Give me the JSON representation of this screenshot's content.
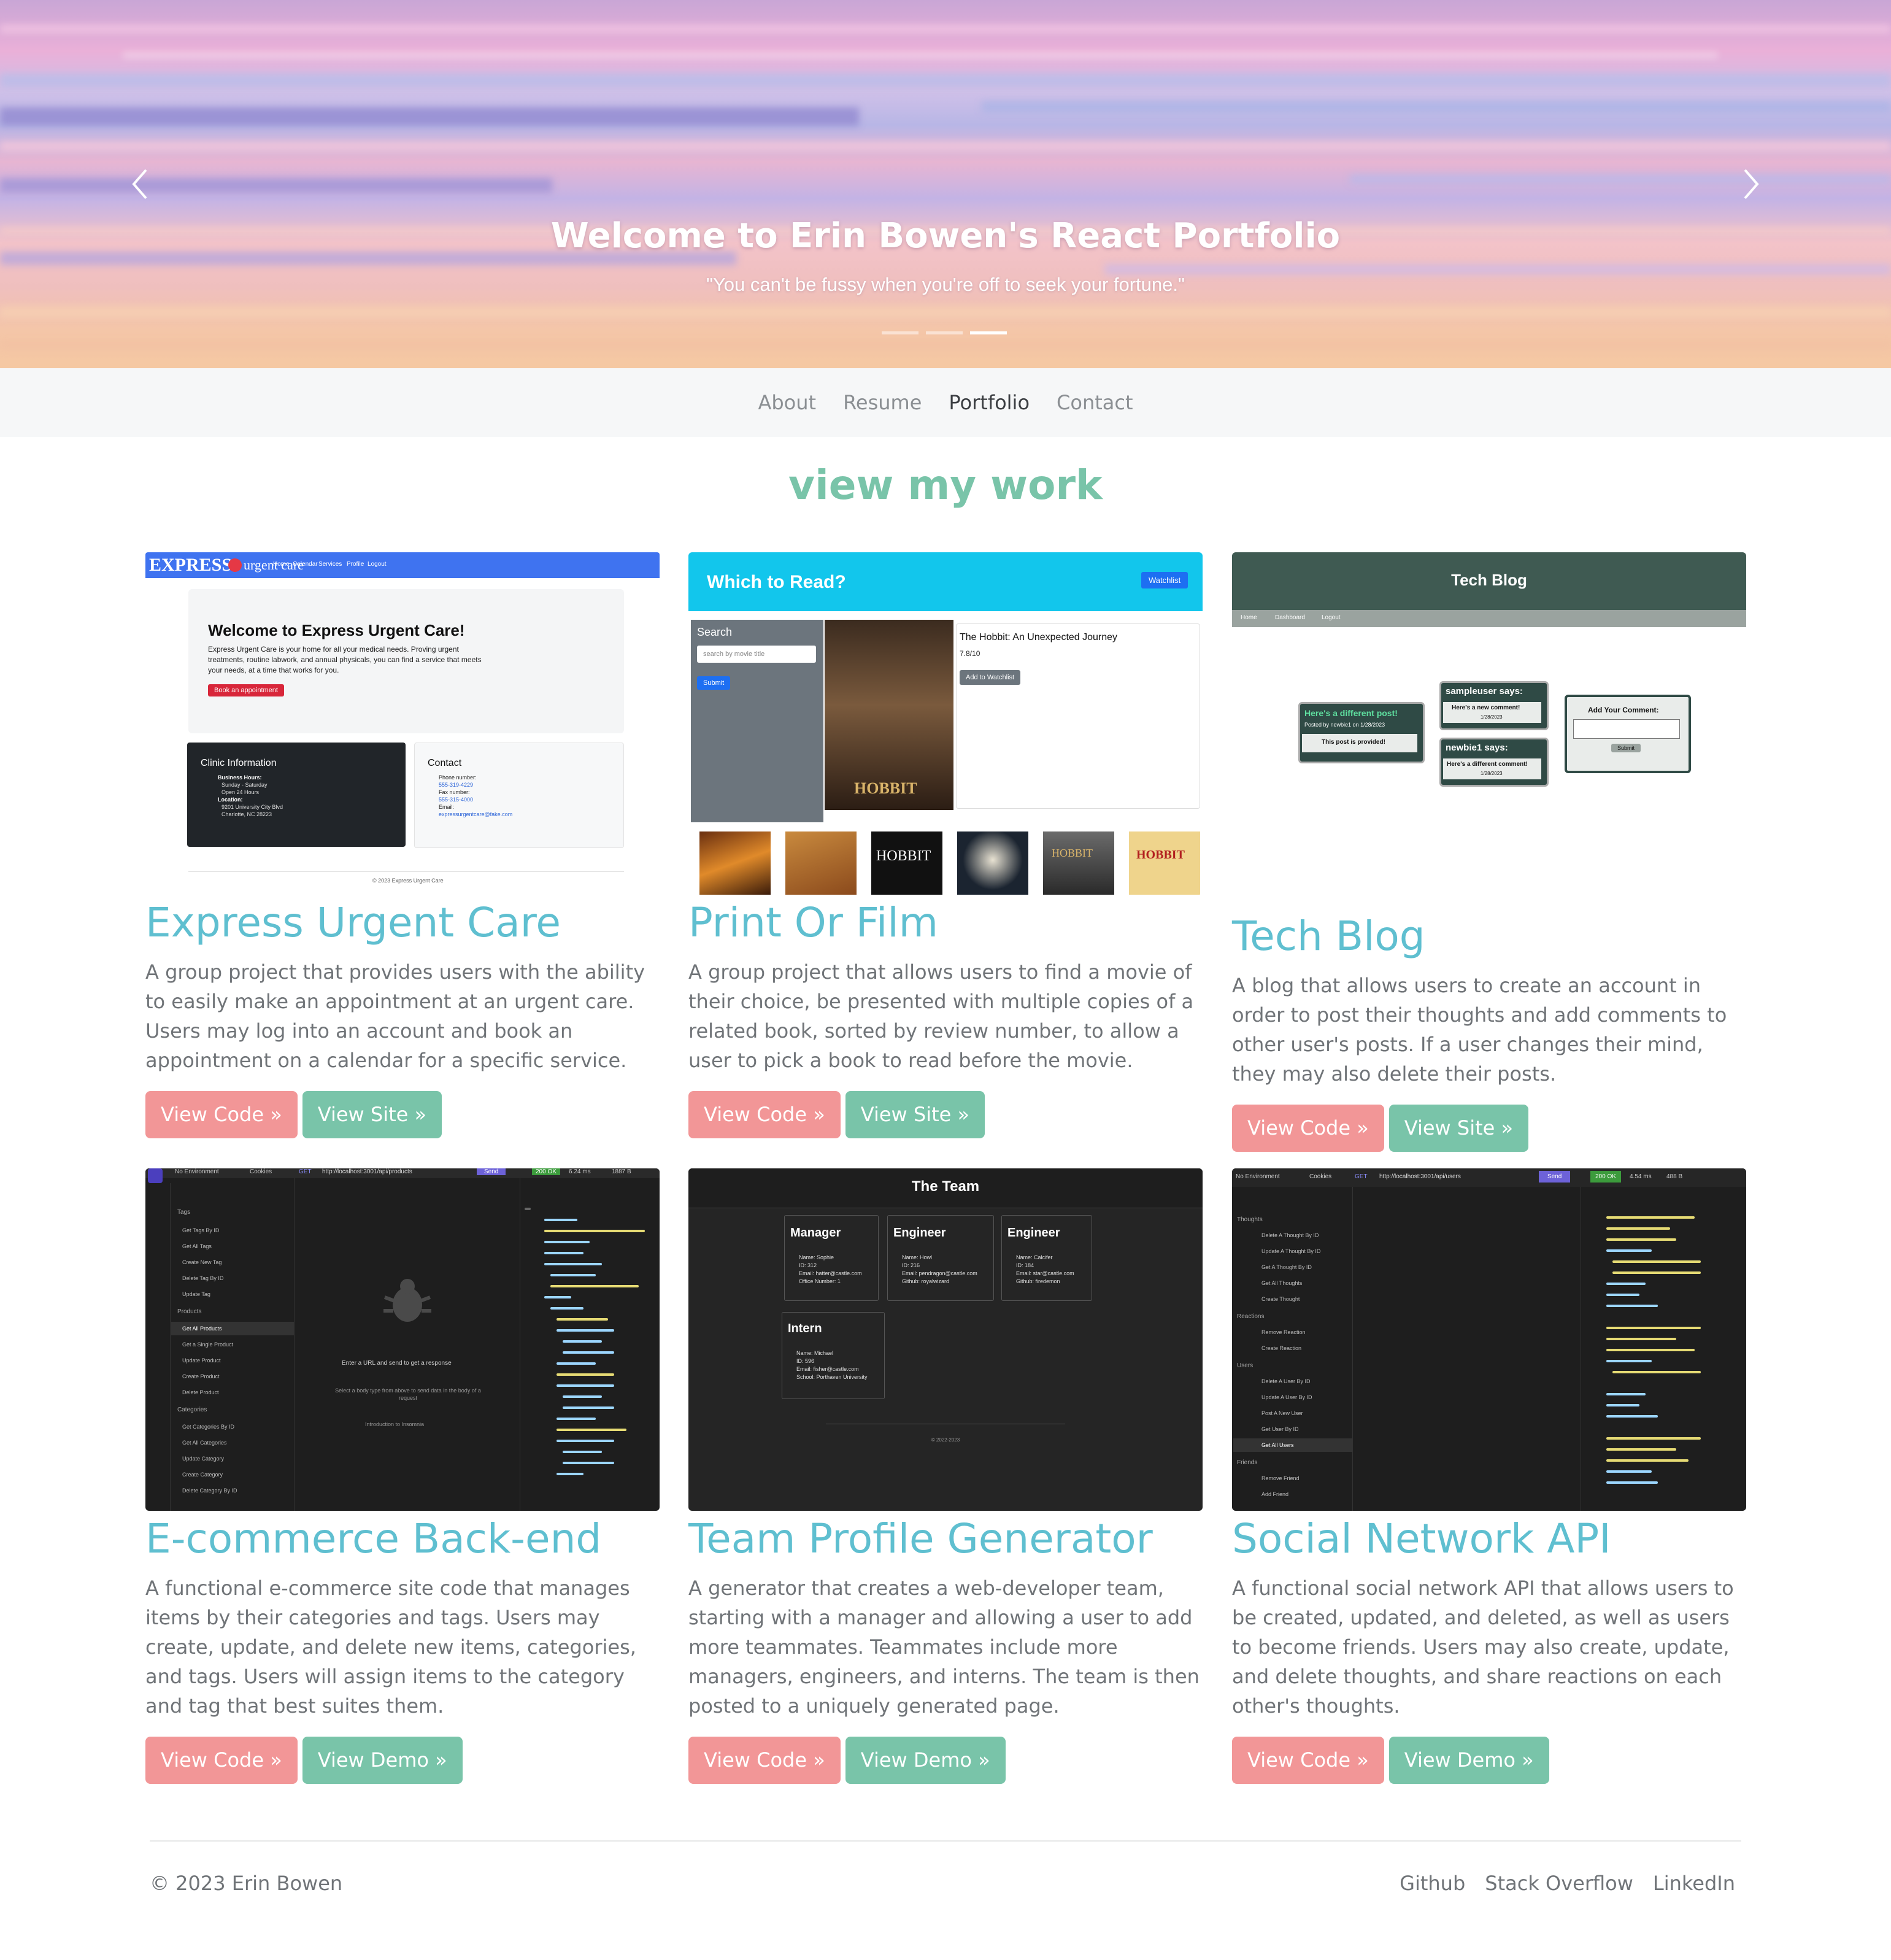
{
  "hero": {
    "title": "Welcome to Erin Bowen's React Portfolio",
    "quote": "\"You can't be fussy when you're off to seek your fortune.\"",
    "slide_count": 3,
    "active_slide": 3
  },
  "nav": {
    "items": [
      {
        "label": "About",
        "active": false
      },
      {
        "label": "Resume",
        "active": false
      },
      {
        "label": "Portfolio",
        "active": true
      },
      {
        "label": "Contact",
        "active": false
      }
    ]
  },
  "section": {
    "title": "view my work"
  },
  "projects": [
    {
      "title": "Express Urgent Care",
      "description": "A group project that provides users with the ability to easily make an appointment at an urgent care. Users may log into an account and book an appointment on a calendar for a specific service.",
      "buttons": [
        "View Code »",
        "View Site »"
      ],
      "screenshot": {
        "brand": "EXPRESS",
        "brand2": "urgent care",
        "nav": [
          "Home",
          "Calendar",
          "Services",
          "Profile",
          "Logout"
        ],
        "heading": "Welcome to Express Urgent Care!",
        "body": "Express Urgent Care is your home for all your medical needs. Proving urgent treatments, routine labwork, and annual physicals, you can find a service that meets your needs, at a time that works for you.",
        "cta": "Book an appointment",
        "clinic_title": "Clinic Information",
        "clinic_lines": [
          "Business Hours:",
          "Sunday - Saturday",
          "Open 24 Hours",
          "Location:",
          "9201 University City Blvd",
          "Charlotte, NC 28223"
        ],
        "contact_title": "Contact",
        "contact_lines": [
          "Phone number:",
          "555-319-4229",
          "Fax number:",
          "555-315-4000",
          "Email:",
          "expressurgentcare@fake.com"
        ],
        "footer": "© 2023 Express Urgent Care"
      }
    },
    {
      "title": "Print Or Film",
      "description": "A group project that allows users to find a movie of their choice, be presented with multiple copies of a related book, sorted by review number, to allow a user to pick a book to read before the movie.",
      "buttons": [
        "View Code »",
        "View Site »"
      ],
      "screenshot": {
        "app_title": "Which to Read?",
        "watchlist": "Watchlist",
        "search_label": "Search",
        "search_placeholder": "search by movie title",
        "submit": "Submit",
        "movie_title": "The Hobbit: An Unexpected Journey",
        "rating": "7.8/10",
        "add_button": "Add to Watchlist",
        "book_covers": [
          "HOBBIT",
          "HOBBIT",
          "HOBBIT",
          "",
          "HOBBIT",
          "HOBBIT"
        ]
      }
    },
    {
      "title": "Tech Blog",
      "description": "A blog that allows users to create an account in order to post their thoughts and add comments to other user's posts. If a user changes their mind, they may also delete their posts.",
      "buttons": [
        "View Code »",
        "View Site »"
      ],
      "screenshot": {
        "header": "Tech Blog",
        "nav": [
          "Home",
          "Dashboard",
          "Logout"
        ],
        "post_title": "Here's a different post!",
        "post_meta": "Posted by newbie1 on 1/28/2023",
        "post_body": "This post is provided!",
        "comment1_user": "sampleuser says:",
        "comment1_body": "Here's a new comment!",
        "comment1_date": "1/28/2023",
        "comment2_user": "newbie1 says:",
        "comment2_body": "Here's a different comment!",
        "comment2_date": "1/28/2023",
        "add_comment": "Add Your Comment:",
        "submit": "Submit"
      }
    },
    {
      "title": "E-commerce Back-end",
      "description": "A functional e-commerce site code that manages items by their categories and tags. Users may create, update, and delete new items, categories, and tags. Users will assign items to the category and tag that best suites them.",
      "buttons": [
        "View Code »",
        "View Demo »"
      ],
      "screenshot": {
        "env": "No Environment",
        "cookies": "Cookies",
        "method": "GET",
        "url": "http://localhost:3001/api/products",
        "send": "Send",
        "status": "200 OK",
        "time": "6.24 ms",
        "size": "1887 B",
        "folders": [
          "Tags",
          "Products",
          "Categories"
        ],
        "requests": [
          "Get Tags By ID",
          "Get All Tags",
          "Create New Tag",
          "Delete Tag By ID",
          "Update Tag",
          "Get All Products",
          "Get a Single Product",
          "Update Product",
          "Create Product",
          "Delete Product",
          "Get Categories By ID",
          "Get All Categories",
          "Update Category",
          "Create Category",
          "Delete Category By ID"
        ],
        "hint1": "Enter a URL and send to get a response",
        "hint2": "Select a body type from above to send data in the body of a request",
        "hint3": "Introduction to Insomnia"
      }
    },
    {
      "title": "Team Profile Generator",
      "description": "A generator that creates a web-developer team, starting with a manager and allowing a user to add more teammates. Teammates include more managers, engineers, and interns. The team is then posted to a uniquely generated page.",
      "buttons": [
        "View Code »",
        "View Demo »"
      ],
      "screenshot": {
        "header": "The Team",
        "members": [
          {
            "role": "Manager",
            "lines": [
              "Name: Sophie",
              "ID: 312",
              "Email: hatter@castle.com",
              "Office Number: 1"
            ]
          },
          {
            "role": "Engineer",
            "lines": [
              "Name: Howl",
              "ID: 216",
              "Email: pendragon@castle.com",
              "Github: royalwizard"
            ]
          },
          {
            "role": "Engineer",
            "lines": [
              "Name: Calcifer",
              "ID: 184",
              "Email: star@castle.com",
              "Github: firedemon"
            ]
          },
          {
            "role": "Intern",
            "lines": [
              "Name: Michael",
              "ID: 596",
              "Email: fisher@castle.com",
              "School: Porthaven University"
            ]
          }
        ],
        "footer": "© 2022-2023"
      }
    },
    {
      "title": "Social Network API",
      "description": "A functional social network API that allows users to be created, updated, and deleted, as well as users to become friends. Users may also create, update, and delete thoughts, and share reactions on each other's thoughts.",
      "buttons": [
        "View Code »",
        "View Demo »"
      ],
      "screenshot": {
        "env": "No Environment",
        "cookies": "Cookies",
        "method": "GET",
        "url": "http://localhost:3001/api/users",
        "send": "Send",
        "status": "200 OK",
        "time": "4.54 ms",
        "size": "488 B",
        "folders": [
          "Thoughts",
          "Reactions",
          "Users",
          "Friends"
        ],
        "requests": [
          "Delete A Thought By ID",
          "Update A Thought By ID",
          "Get A Thought By ID",
          "Get All Thoughts",
          "Create Thought",
          "Remove Reaction",
          "Create Reaction",
          "Delete A User By ID",
          "Update A User By ID",
          "Post A New User",
          "Get User By ID",
          "Get All Users",
          "Remove Friend",
          "Add Friend"
        ]
      }
    }
  ],
  "footer": {
    "copyright": "© 2023 Erin Bowen",
    "links": [
      "Github",
      "Stack Overflow",
      "LinkedIn"
    ]
  },
  "colors": {
    "accent_green": "#79c4a9",
    "accent_coral": "#f29697",
    "title_blue": "#5fbfd0",
    "text_gray": "#707478"
  }
}
